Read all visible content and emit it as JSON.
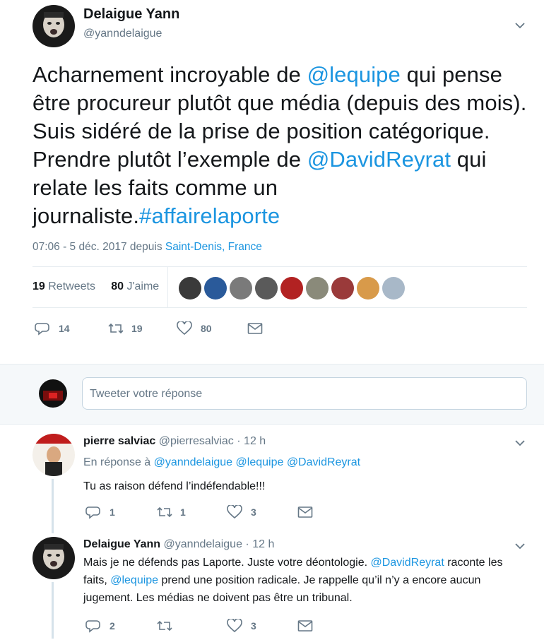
{
  "tweet": {
    "author_name": "Delaigue Yann",
    "author_handle": "@yanndelaigue",
    "text_parts": [
      {
        "t": "Acharnement incroyable de ",
        "link": false
      },
      {
        "t": "@lequipe",
        "link": true
      },
      {
        "t": " qui pense être procureur plutôt que média (depuis des mois). Suis sidéré de la prise de position catégorique.  Prendre plutôt l’exemple de ",
        "link": false
      },
      {
        "t": "@DavidReyrat",
        "link": true
      },
      {
        "t": " qui relate les faits comme un journaliste.",
        "link": false
      },
      {
        "t": "#affairelaporte",
        "link": true
      }
    ],
    "time": "07:06 - 5 déc. 2017",
    "via": "depuis",
    "location": "Saint-Denis, France",
    "retweets_count": "19",
    "retweets_label": "Retweets",
    "likes_count": "80",
    "likes_label": "J'aime",
    "liker_colors": [
      "#3a3a3a",
      "#2a5a9a",
      "#7a7a7a",
      "#5a5a5a",
      "#b22222",
      "#8a8a7a",
      "#9a3a3a",
      "#d89a4a",
      "#a8b8c8"
    ],
    "actions": {
      "reply": "14",
      "retweet": "19",
      "like": "80"
    }
  },
  "reply_box": {
    "placeholder": "Tweeter votre réponse"
  },
  "replies": [
    {
      "name": "pierre salviac",
      "handle": "@pierresalviac",
      "time": "· 12 h",
      "in_reply_prefix": "En réponse à",
      "in_reply_handles": "@yanndelaigue @lequipe @DavidReyrat",
      "text": "Tu as raison défend l’indéfendable!!!",
      "reply_count": "1",
      "retweet_count": "1",
      "like_count": "3"
    },
    {
      "name": "Delaigue Yann",
      "handle": "@yanndelaigue",
      "time": "· 12 h",
      "text_parts": [
        {
          "t": "Mais je ne défends pas Laporte. Juste votre déontologie. ",
          "link": false
        },
        {
          "t": "@DavidReyrat",
          "link": true
        },
        {
          "t": " raconte les faits, ",
          "link": false
        },
        {
          "t": "@lequipe",
          "link": true
        },
        {
          "t": " prend une position radicale. Je rappelle qu’il n’y a encore aucun jugement. Les médias ne doivent pas être un tribunal.",
          "link": false
        }
      ],
      "reply_count": "2",
      "retweet_count": "",
      "like_count": "3"
    }
  ]
}
